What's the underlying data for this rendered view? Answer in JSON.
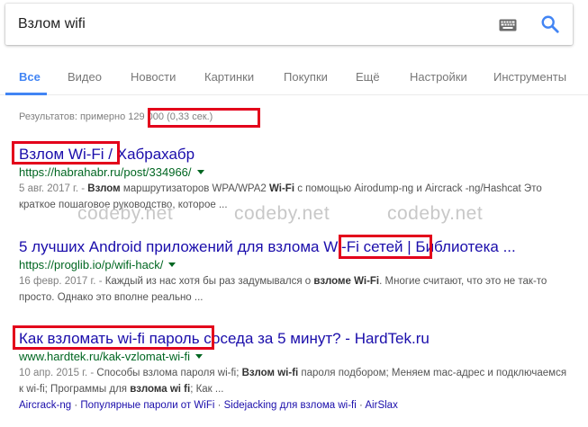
{
  "search": {
    "query": "Взлом wifi"
  },
  "tabs": [
    {
      "label": "Все",
      "active": true
    },
    {
      "label": "Видео"
    },
    {
      "label": "Новости"
    },
    {
      "label": "Картинки"
    },
    {
      "label": "Покупки"
    },
    {
      "label": "Ещё"
    },
    {
      "label": "Настройки"
    },
    {
      "label": "Инструменты"
    }
  ],
  "stats": {
    "prefix": "Результатов: примерно ",
    "count": "129 000 (0,33 сек.)"
  },
  "results": [
    {
      "title_main": "Взлом Wi-Fi",
      "title_rest": " / Хабрахабр",
      "url": "https://habrahabr.ru/post/334966/",
      "date": "5 авг. 2017 г. - ",
      "snippet_b1": "Взлом",
      "snippet_t1": " маршрутизаторов WPA/WPA2 ",
      "snippet_b2": "Wi-Fi",
      "snippet_t2": " с помощью Airodump-ng и Aircrack -ng/Hashcat Это краткое пошаговое руководство, которое ..."
    },
    {
      "title_a": "5 лучших Android приложений для взлома ",
      "title_b": "Wi-Fi сетей",
      "title_c": " | Библиотека ...",
      "url": "https://proglib.io/p/wifi-hack/",
      "date": "16 февр. 2017 г. - ",
      "snippet_t1": "Каждый из нас хотя бы раз задумывался о ",
      "snippet_b1": "взломе Wi-Fi",
      "snippet_t2": ". Многие считают, что это не так-то просто. Однако это вполне реально ..."
    },
    {
      "title_a": "Как взломать wi-fi пароль",
      "title_b": " соседа за 5 минут? - HardTek.ru",
      "url": "www.hardtek.ru/kak-vzlomat-wi-fi",
      "date": "10 апр. 2015 г. - ",
      "snippet_t1": "Способы взлома пароля wi-fi; ",
      "snippet_b1": "Взлом wi-fi",
      "snippet_t2": " пароля подбором; Меняем mac-адрес и подключаемся к wi-fi; Программы для ",
      "snippet_b2": "взлома wi fi",
      "snippet_t3": "; Как ...",
      "sitelinks": [
        "Aircrack-ng",
        "Популярные пароли от WiFi",
        "Sidejacking для взлома wi-fi",
        "AirSlax"
      ]
    }
  ],
  "watermark": "codeby.net",
  "colors": {
    "accent": "#4285f4",
    "link": "#1a0dab",
    "url": "#006621",
    "highlight": "#e3001b"
  }
}
